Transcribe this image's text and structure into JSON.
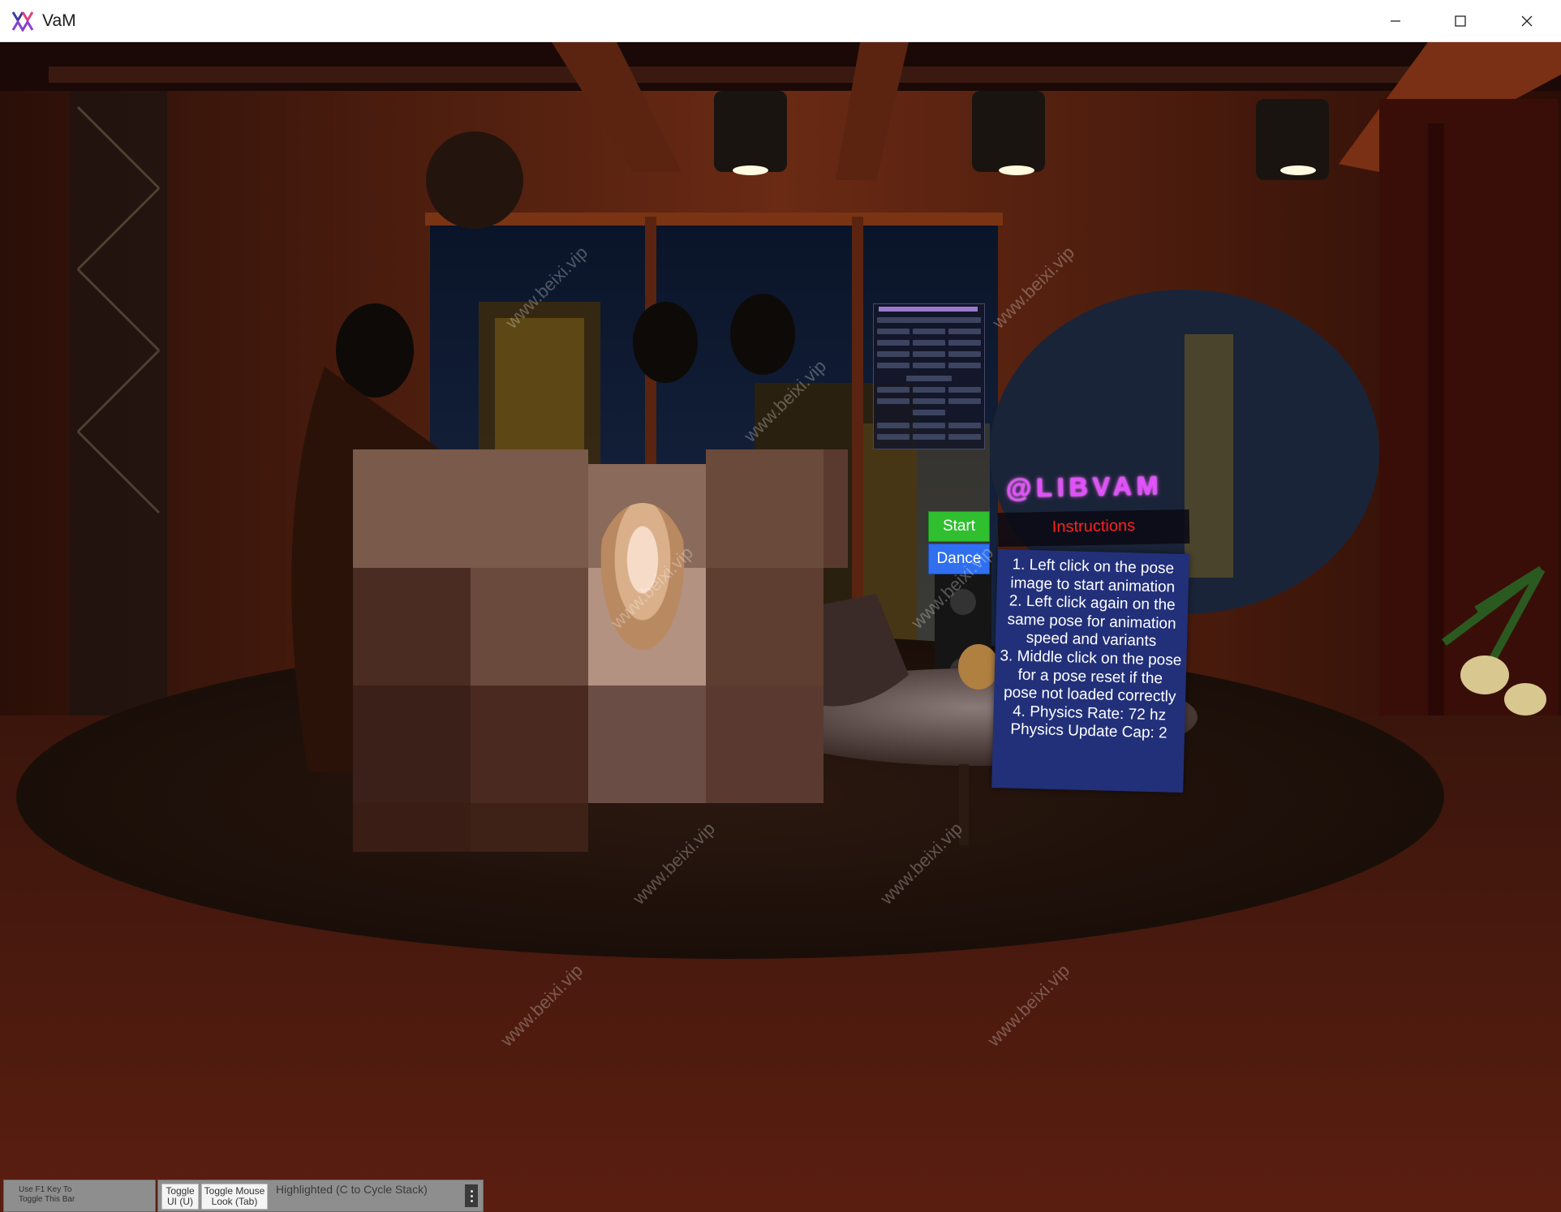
{
  "window": {
    "title": "VaM",
    "controls": [
      "minimize-icon",
      "maximize-icon",
      "close-icon"
    ]
  },
  "scene": {
    "brand_title": "@LIBVAM",
    "instructions_title": "Instructions",
    "instructions_text": "1. Left click on the pose image to start animation\n2. Left click again on the same pose for animation speed and variants\n3. Middle click on the pose for a pose reset if the pose not loaded correctly\n4. Physics Rate: 72 hz\nPhysics Update Cap: 2",
    "start_label": "Start",
    "dance_label": "Dance",
    "watermark": "www.beixi.vip"
  },
  "bottom_bar": {
    "f1_hint_line1": "Use F1 Key To",
    "f1_hint_line2": "Toggle This Bar",
    "toggle_ui_line1": "Toggle",
    "toggle_ui_line2": "UI (U)",
    "toggle_mouse_line1": "Toggle Mouse",
    "toggle_mouse_line2": "Look (Tab)",
    "status": "Highlighted (C to Cycle Stack)"
  },
  "colors": {
    "start_button": "#2fbf2f",
    "dance_button": "#2f6ff0",
    "instructions_panel": "#22307a",
    "instructions_title": "#ff2020",
    "brand_title": "#e050ff"
  }
}
